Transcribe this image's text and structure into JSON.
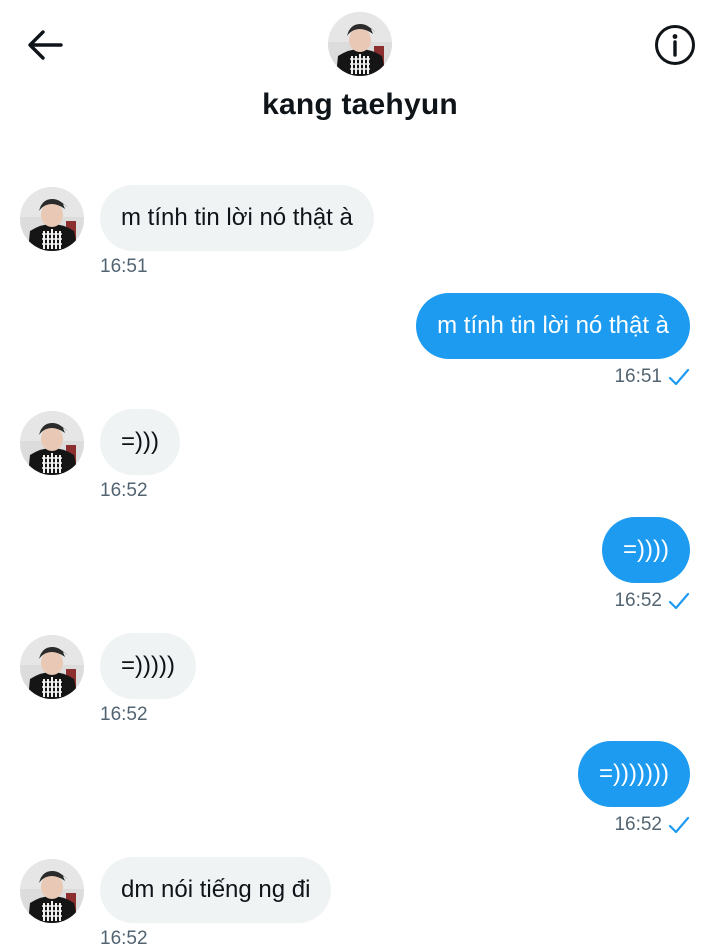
{
  "header": {
    "title": "kang taehyun",
    "back_icon": "arrow-left-icon",
    "info_icon": "info-circle-icon"
  },
  "colors": {
    "accent": "#1d9bf0",
    "incoming_bubble": "#eff3f4",
    "timestamp": "#536471"
  },
  "messages": [
    {
      "direction": "in",
      "text": "m tính tin lời nó thật à",
      "time": "16:51"
    },
    {
      "direction": "out",
      "text": "m tính tin lời nó thật à",
      "time": "16:51",
      "status_icon": "check-icon"
    },
    {
      "direction": "in",
      "text": "=)))",
      "time": "16:52"
    },
    {
      "direction": "out",
      "text": "=))))",
      "time": "16:52",
      "status_icon": "check-icon"
    },
    {
      "direction": "in",
      "text": "=)))))",
      "time": "16:52"
    },
    {
      "direction": "out",
      "text": "=)))))))",
      "time": "16:52",
      "status_icon": "check-icon"
    },
    {
      "direction": "in",
      "text": "dm nói tiếng ng đi",
      "time": "16:52"
    }
  ]
}
